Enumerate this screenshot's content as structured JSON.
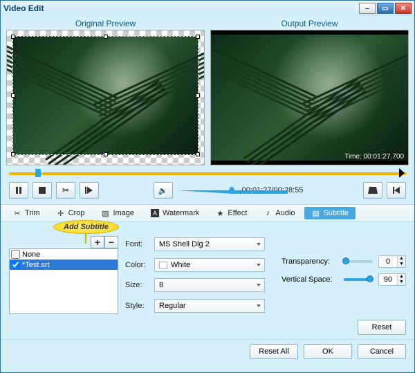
{
  "window": {
    "title": "Video Edit"
  },
  "preview": {
    "original_label": "Original Preview",
    "output_label": "Output Preview",
    "timecode": "Time: 00:01:27.700"
  },
  "playback": {
    "time_display": "00:01:27/00:28:55"
  },
  "tabs": {
    "trim": "Trim",
    "crop": "Crop",
    "image": "Image",
    "watermark": "Watermark",
    "effect": "Effect",
    "audio": "Audio",
    "subtitle": "Subtitle"
  },
  "callout": {
    "text": "Add Subtitle"
  },
  "subtitle_list": {
    "items": [
      {
        "label": "None",
        "checked": false,
        "selected": false
      },
      {
        "label": "*Test.srt",
        "checked": true,
        "selected": true
      }
    ]
  },
  "form": {
    "font_label": "Font:",
    "font_value": "MS Shell Dlg 2",
    "color_label": "Color:",
    "color_value": "White",
    "size_label": "Size:",
    "size_value": "8",
    "style_label": "Style:",
    "style_value": "Regular"
  },
  "sliders": {
    "transparency_label": "Transparency:",
    "transparency_value": "0",
    "vspace_label": "Vertical Space:",
    "vspace_value": "90"
  },
  "buttons": {
    "reset": "Reset",
    "reset_all": "Reset All",
    "ok": "OK",
    "cancel": "Cancel"
  }
}
